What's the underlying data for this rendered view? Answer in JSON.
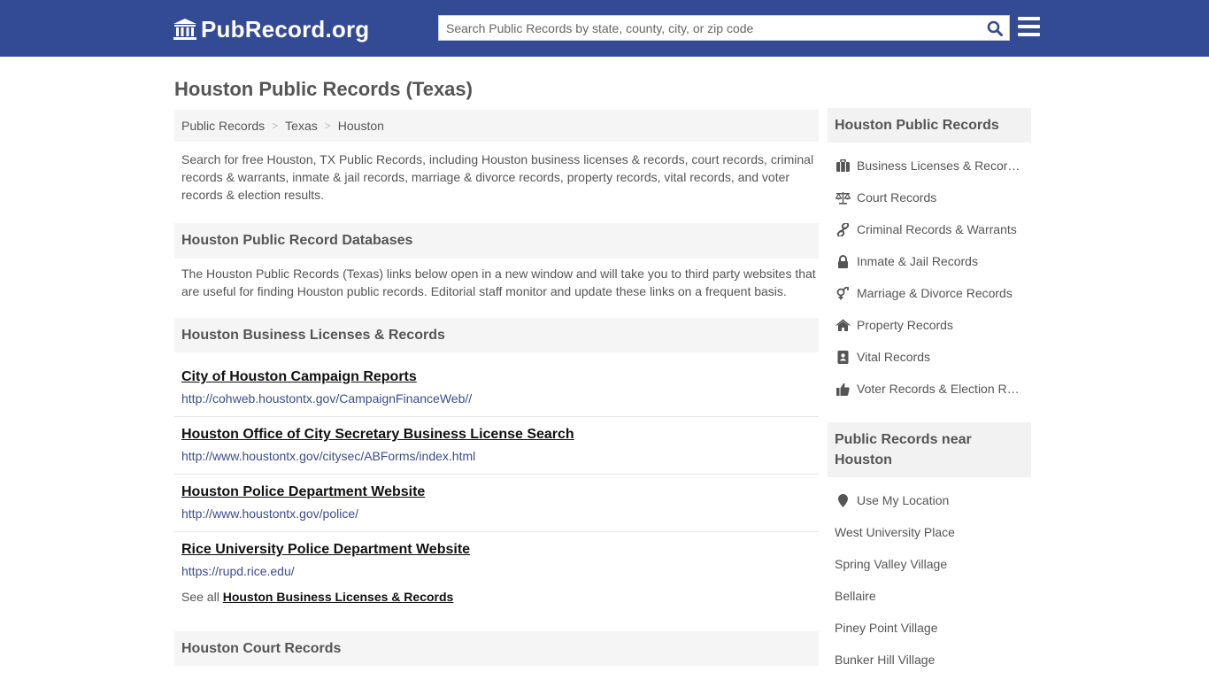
{
  "header": {
    "logo_text": "PubRecord.org",
    "search_placeholder": "Search Public Records by state, county, city, or zip code"
  },
  "page": {
    "title": "Houston Public Records (Texas)",
    "breadcrumb": [
      "Public Records",
      "Texas",
      "Houston"
    ],
    "intro": "Search for free Houston, TX Public Records, including Houston business licenses & records, court records, criminal records & warrants, inmate & jail records, marriage & divorce records, property records, vital records, and voter records & election results."
  },
  "databases": {
    "heading": "Houston Public Record Databases",
    "description": "The Houston Public Records (Texas) links below open in a new window and will take you to third party websites that are useful for finding Houston public records. Editorial staff monitor and update these links on a frequent basis."
  },
  "business": {
    "heading": "Houston Business Licenses & Records",
    "records": [
      {
        "title": "City of Houston Campaign Reports",
        "url": "http://cohweb.houstontx.gov/CampaignFinanceWeb//"
      },
      {
        "title": "Houston Office of City Secretary Business License Search",
        "url": "http://www.houstontx.gov/citysec/ABForms/index.html"
      },
      {
        "title": "Houston Police Department Website",
        "url": "http://www.houstontx.gov/police/"
      },
      {
        "title": "Rice University Police Department Website",
        "url": "https://rupd.rice.edu/"
      }
    ],
    "see_all_prefix": "See all",
    "see_all_link": "Houston Business Licenses & Records"
  },
  "court": {
    "heading": "Houston Court Records"
  },
  "sidebar": {
    "records_heading": "Houston Public Records",
    "items": [
      {
        "label": "Business Licenses & Records",
        "icon": "briefcase-icon"
      },
      {
        "label": "Court Records",
        "icon": "scale-icon"
      },
      {
        "label": "Criminal Records & Warrants",
        "icon": "link-icon"
      },
      {
        "label": "Inmate & Jail Records",
        "icon": "lock-icon"
      },
      {
        "label": "Marriage & Divorce Records",
        "icon": "gender-icon"
      },
      {
        "label": "Property Records",
        "icon": "home-icon"
      },
      {
        "label": "Vital Records",
        "icon": "address-book-icon"
      },
      {
        "label": "Voter Records & Election Results",
        "icon": "thumbs-up-icon"
      }
    ],
    "near_heading": "Public Records near Houston",
    "use_location": "Use My Location",
    "near_places": [
      "West University Place",
      "Spring Valley Village",
      "Bellaire",
      "Piney Point Village",
      "Bunker Hill Village"
    ]
  },
  "colors": {
    "header_bg": "#334a94",
    "link_blue": "#3c4d8c",
    "section_bg": "#f5f5f5"
  }
}
